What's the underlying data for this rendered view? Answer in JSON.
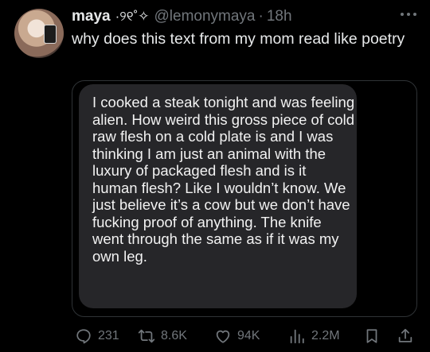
{
  "tweet": {
    "display_name": "maya",
    "name_decoration": "·୨୧˚✧",
    "handle": "@lemonymaya",
    "separator": "·",
    "time": "18h",
    "text": "why does this text from my mom read like poetry"
  },
  "message_bubble": {
    "text": "I cooked a steak tonight and was feeling alien. How weird this gross piece of cold raw flesh on a cold plate is and I was thinking I am just an animal with the luxury of packaged flesh and is it human flesh? Like I wouldn’t know. We just believe it’s a cow but we don’t have fucking proof of anything. The knife went through the same as if it was my own leg."
  },
  "actions": {
    "replies": "231",
    "reposts": "8.6K",
    "likes": "94K",
    "views": "2.2M"
  },
  "icons": [
    "more-icon",
    "reply-icon",
    "repost-icon",
    "like-icon",
    "views-icon",
    "bookmark-icon",
    "share-icon"
  ],
  "colors": {
    "background": "#000000",
    "text": "#e7e9ea",
    "muted": "#71767b",
    "bubble": "#262629",
    "border": "#2f3336"
  }
}
